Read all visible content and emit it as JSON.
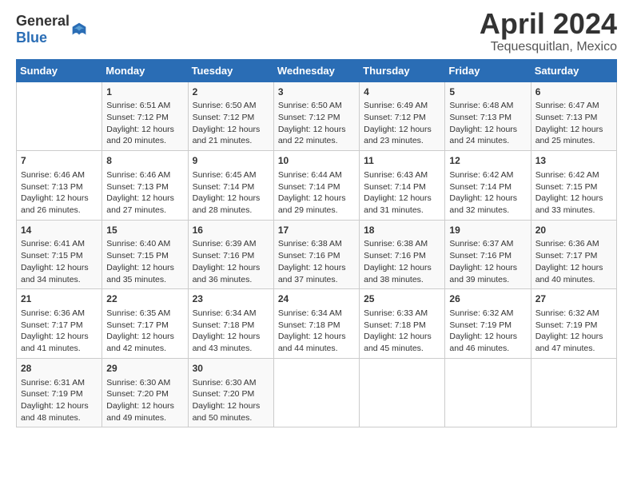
{
  "header": {
    "logo_general": "General",
    "logo_blue": "Blue",
    "month_title": "April 2024",
    "location": "Tequesquitlan, Mexico"
  },
  "days_of_week": [
    "Sunday",
    "Monday",
    "Tuesday",
    "Wednesday",
    "Thursday",
    "Friday",
    "Saturday"
  ],
  "weeks": [
    [
      {
        "day": "",
        "info": ""
      },
      {
        "day": "1",
        "info": "Sunrise: 6:51 AM\nSunset: 7:12 PM\nDaylight: 12 hours and 20 minutes."
      },
      {
        "day": "2",
        "info": "Sunrise: 6:50 AM\nSunset: 7:12 PM\nDaylight: 12 hours and 21 minutes."
      },
      {
        "day": "3",
        "info": "Sunrise: 6:50 AM\nSunset: 7:12 PM\nDaylight: 12 hours and 22 minutes."
      },
      {
        "day": "4",
        "info": "Sunrise: 6:49 AM\nSunset: 7:12 PM\nDaylight: 12 hours and 23 minutes."
      },
      {
        "day": "5",
        "info": "Sunrise: 6:48 AM\nSunset: 7:13 PM\nDaylight: 12 hours and 24 minutes."
      },
      {
        "day": "6",
        "info": "Sunrise: 6:47 AM\nSunset: 7:13 PM\nDaylight: 12 hours and 25 minutes."
      }
    ],
    [
      {
        "day": "7",
        "info": "Sunrise: 6:46 AM\nSunset: 7:13 PM\nDaylight: 12 hours and 26 minutes."
      },
      {
        "day": "8",
        "info": "Sunrise: 6:46 AM\nSunset: 7:13 PM\nDaylight: 12 hours and 27 minutes."
      },
      {
        "day": "9",
        "info": "Sunrise: 6:45 AM\nSunset: 7:14 PM\nDaylight: 12 hours and 28 minutes."
      },
      {
        "day": "10",
        "info": "Sunrise: 6:44 AM\nSunset: 7:14 PM\nDaylight: 12 hours and 29 minutes."
      },
      {
        "day": "11",
        "info": "Sunrise: 6:43 AM\nSunset: 7:14 PM\nDaylight: 12 hours and 31 minutes."
      },
      {
        "day": "12",
        "info": "Sunrise: 6:42 AM\nSunset: 7:14 PM\nDaylight: 12 hours and 32 minutes."
      },
      {
        "day": "13",
        "info": "Sunrise: 6:42 AM\nSunset: 7:15 PM\nDaylight: 12 hours and 33 minutes."
      }
    ],
    [
      {
        "day": "14",
        "info": "Sunrise: 6:41 AM\nSunset: 7:15 PM\nDaylight: 12 hours and 34 minutes."
      },
      {
        "day": "15",
        "info": "Sunrise: 6:40 AM\nSunset: 7:15 PM\nDaylight: 12 hours and 35 minutes."
      },
      {
        "day": "16",
        "info": "Sunrise: 6:39 AM\nSunset: 7:16 PM\nDaylight: 12 hours and 36 minutes."
      },
      {
        "day": "17",
        "info": "Sunrise: 6:38 AM\nSunset: 7:16 PM\nDaylight: 12 hours and 37 minutes."
      },
      {
        "day": "18",
        "info": "Sunrise: 6:38 AM\nSunset: 7:16 PM\nDaylight: 12 hours and 38 minutes."
      },
      {
        "day": "19",
        "info": "Sunrise: 6:37 AM\nSunset: 7:16 PM\nDaylight: 12 hours and 39 minutes."
      },
      {
        "day": "20",
        "info": "Sunrise: 6:36 AM\nSunset: 7:17 PM\nDaylight: 12 hours and 40 minutes."
      }
    ],
    [
      {
        "day": "21",
        "info": "Sunrise: 6:36 AM\nSunset: 7:17 PM\nDaylight: 12 hours and 41 minutes."
      },
      {
        "day": "22",
        "info": "Sunrise: 6:35 AM\nSunset: 7:17 PM\nDaylight: 12 hours and 42 minutes."
      },
      {
        "day": "23",
        "info": "Sunrise: 6:34 AM\nSunset: 7:18 PM\nDaylight: 12 hours and 43 minutes."
      },
      {
        "day": "24",
        "info": "Sunrise: 6:34 AM\nSunset: 7:18 PM\nDaylight: 12 hours and 44 minutes."
      },
      {
        "day": "25",
        "info": "Sunrise: 6:33 AM\nSunset: 7:18 PM\nDaylight: 12 hours and 45 minutes."
      },
      {
        "day": "26",
        "info": "Sunrise: 6:32 AM\nSunset: 7:19 PM\nDaylight: 12 hours and 46 minutes."
      },
      {
        "day": "27",
        "info": "Sunrise: 6:32 AM\nSunset: 7:19 PM\nDaylight: 12 hours and 47 minutes."
      }
    ],
    [
      {
        "day": "28",
        "info": "Sunrise: 6:31 AM\nSunset: 7:19 PM\nDaylight: 12 hours and 48 minutes."
      },
      {
        "day": "29",
        "info": "Sunrise: 6:30 AM\nSunset: 7:20 PM\nDaylight: 12 hours and 49 minutes."
      },
      {
        "day": "30",
        "info": "Sunrise: 6:30 AM\nSunset: 7:20 PM\nDaylight: 12 hours and 50 minutes."
      },
      {
        "day": "",
        "info": ""
      },
      {
        "day": "",
        "info": ""
      },
      {
        "day": "",
        "info": ""
      },
      {
        "day": "",
        "info": ""
      }
    ]
  ]
}
